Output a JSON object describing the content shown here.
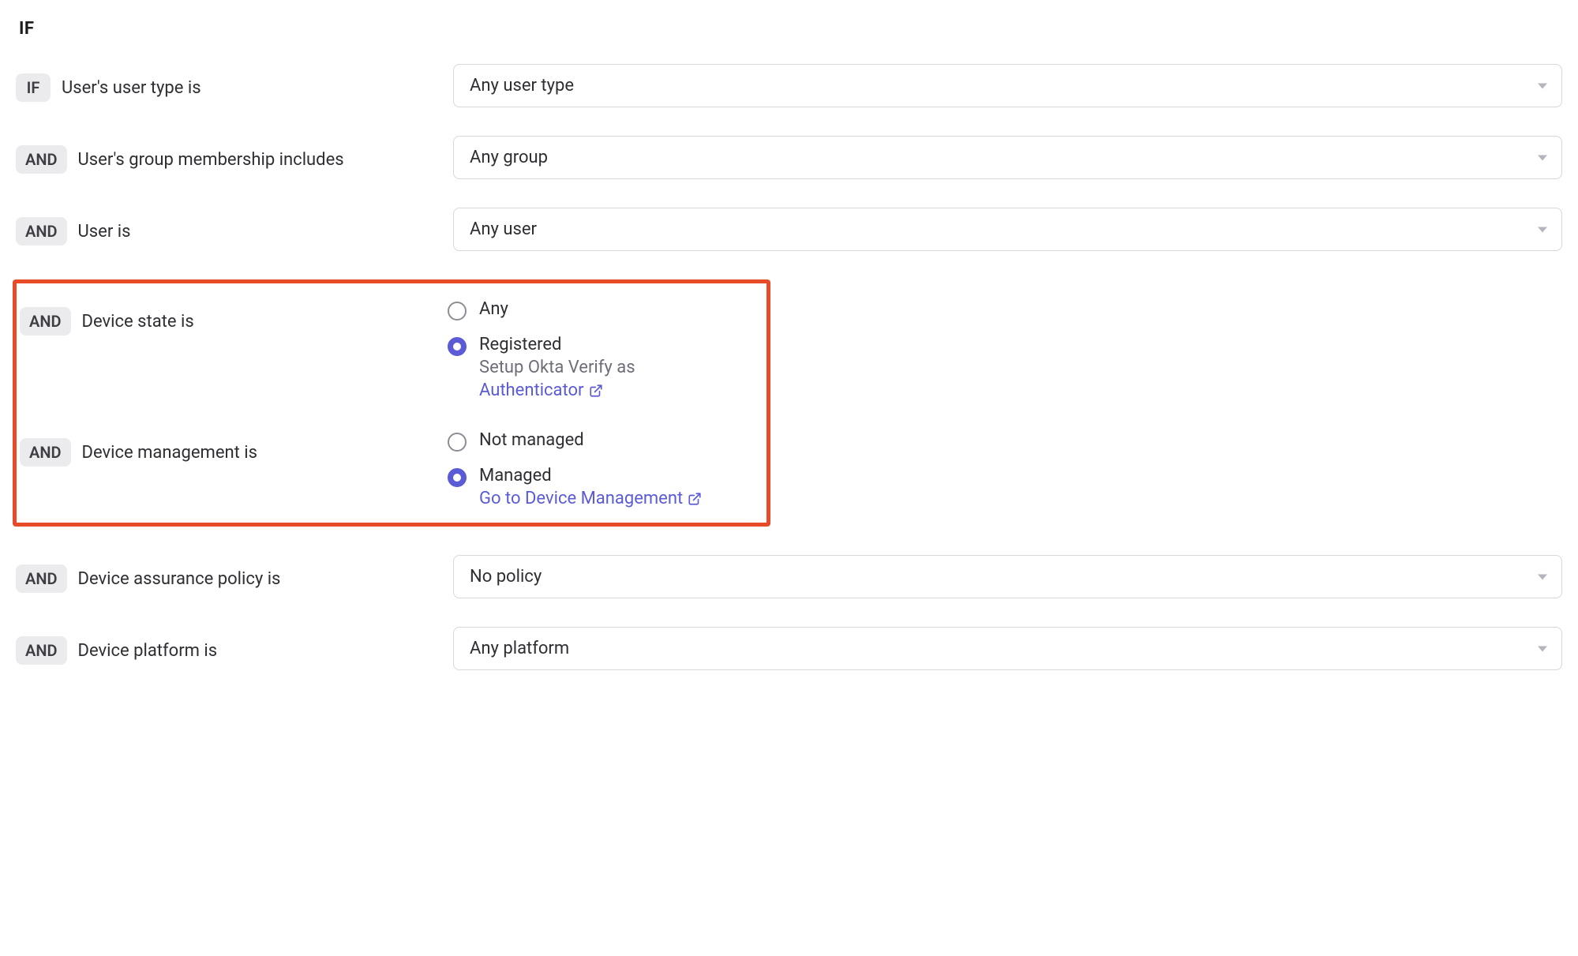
{
  "section_header": "IF",
  "ops": {
    "if": "IF",
    "and": "AND"
  },
  "user_type": {
    "label": "User's user type is",
    "value": "Any user type"
  },
  "group_membership": {
    "label": "User's group membership includes",
    "value": "Any group"
  },
  "user_is": {
    "label": "User is",
    "value": "Any user"
  },
  "device_state": {
    "label": "Device state is",
    "options": {
      "any": "Any",
      "registered": "Registered"
    },
    "helper_prefix": "Setup Okta Verify as ",
    "helper_link": "Authenticator"
  },
  "device_management": {
    "label": "Device management is",
    "options": {
      "not_managed": "Not managed",
      "managed": "Managed"
    },
    "helper_link": "Go to Device Management"
  },
  "device_assurance": {
    "label": "Device assurance policy is",
    "value": "No policy"
  },
  "device_platform": {
    "label": "Device platform is",
    "value": "Any platform"
  }
}
